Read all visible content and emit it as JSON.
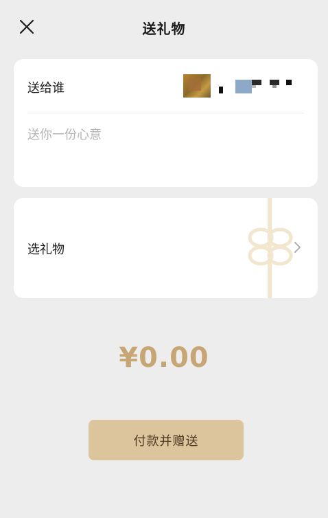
{
  "nav": {
    "title": "送礼物",
    "close_icon": "close-icon"
  },
  "recipient": {
    "label": "送给谁",
    "name_obscured": true
  },
  "message": {
    "placeholder": "送你一份心意",
    "value": ""
  },
  "gift": {
    "label": "选礼物",
    "chevron_icon": "chevron-right-icon",
    "decoration_icon": "ribbon-bow-icon"
  },
  "amount": {
    "text": "¥0.00"
  },
  "pay": {
    "label": "付款并赠送"
  },
  "colors": {
    "background": "#ededed",
    "card": "#ffffff",
    "accent": "#c7a675",
    "button": "#dcc49d",
    "button_text": "#4a3a22",
    "ribbon": "#f3e6cf"
  }
}
